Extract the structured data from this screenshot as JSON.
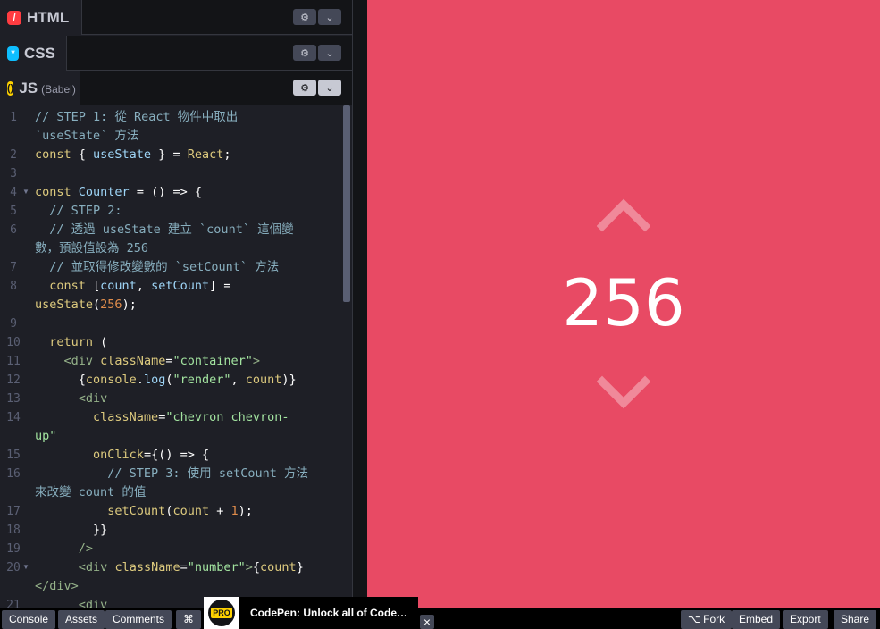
{
  "panels": {
    "html": {
      "title": "HTML"
    },
    "css": {
      "title": "CSS"
    },
    "js": {
      "title": "JS",
      "subtitle": "(Babel)"
    }
  },
  "icons": {
    "settings": "gear-icon",
    "collapse": "chevron-down-icon"
  },
  "code": {
    "gutter": [
      "1",
      "",
      "2",
      "3",
      "4",
      "5",
      "6",
      "",
      "7",
      "8",
      "",
      "9",
      "10",
      "11",
      "12",
      "13",
      "14",
      "",
      "15",
      "16",
      "",
      "17",
      "18",
      "19",
      "20",
      "",
      "21"
    ]
  },
  "preview": {
    "count": "256",
    "background": "#e84a64"
  },
  "bottom": {
    "console": "Console",
    "assets": "Assets",
    "comments": "Comments",
    "shortcuts": "⌘",
    "promo": "CodePen: Unlock all of Code…",
    "pro": "PRO",
    "close": "×",
    "fork": "Fork",
    "embed": "Embed",
    "export": "Export",
    "share": "Share"
  },
  "colors": {
    "editor_bg": "#1e1f26",
    "chrome_bg": "#131417",
    "accent_preview": "#e84a64"
  }
}
